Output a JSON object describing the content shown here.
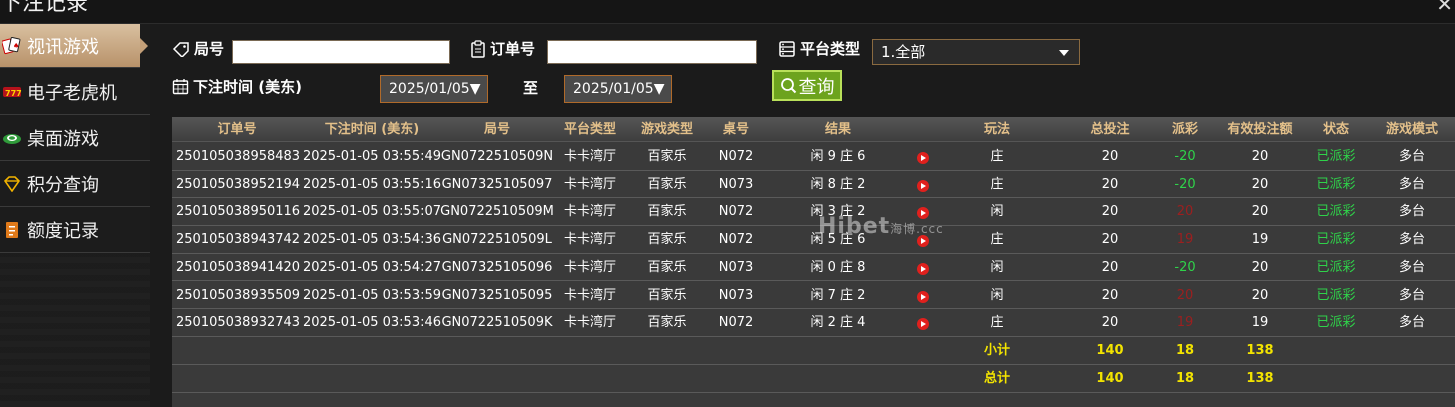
{
  "window": {
    "title": "下注记录",
    "close": "✕"
  },
  "sidebar": {
    "items": [
      {
        "label": "视讯游戏",
        "icon": "cards-icon",
        "active": true
      },
      {
        "label": "电子老虎机",
        "icon": "slot-icon",
        "active": false
      },
      {
        "label": "桌面游戏",
        "icon": "chip-icon",
        "active": false
      },
      {
        "label": "积分查询",
        "icon": "diamond-icon",
        "active": false
      },
      {
        "label": "额度记录",
        "icon": "document-icon",
        "active": false
      }
    ]
  },
  "filters": {
    "round_label": "局号",
    "round_value": "",
    "order_label": "订单号",
    "order_value": "",
    "platform_label": "平台类型",
    "platform_selected": "1.全部",
    "time_label": "下注时间 (美东)",
    "date_from": "2025/01/05▼",
    "to_label": "至",
    "date_to": "2025/01/05▼",
    "query_label": "查询"
  },
  "table": {
    "headers": [
      "订单号",
      "下注时间 (美东)",
      "局号",
      "平台类型",
      "游戏类型",
      "桌号",
      "结果",
      "玩法",
      "总投注",
      "派彩",
      "有效投注额",
      "状态",
      "游戏模式"
    ],
    "rows": [
      [
        "250105038958483",
        "2025-01-05 03:55:49",
        "GN0722510509N",
        "卡卡湾厅",
        "百家乐",
        "N072",
        "闲 9 庄 6",
        "庄",
        "20",
        "-20",
        "20",
        "已派彩",
        "多台"
      ],
      [
        "250105038952194",
        "2025-01-05 03:55:16",
        "GN07325105097",
        "卡卡湾厅",
        "百家乐",
        "N073",
        "闲 8 庄 2",
        "庄",
        "20",
        "-20",
        "20",
        "已派彩",
        "多台"
      ],
      [
        "250105038950116",
        "2025-01-05 03:55:07",
        "GN0722510509M",
        "卡卡湾厅",
        "百家乐",
        "N072",
        "闲 3 庄 2",
        "闲",
        "20",
        "20",
        "20",
        "已派彩",
        "多台"
      ],
      [
        "250105038943742",
        "2025-01-05 03:54:36",
        "GN0722510509L",
        "卡卡湾厅",
        "百家乐",
        "N072",
        "闲 5 庄 6",
        "庄",
        "20",
        "19",
        "19",
        "已派彩",
        "多台"
      ],
      [
        "250105038941420",
        "2025-01-05 03:54:27",
        "GN07325105096",
        "卡卡湾厅",
        "百家乐",
        "N073",
        "闲 0 庄 8",
        "闲",
        "20",
        "-20",
        "20",
        "已派彩",
        "多台"
      ],
      [
        "250105038935509",
        "2025-01-05 03:53:59",
        "GN07325105095",
        "卡卡湾厅",
        "百家乐",
        "N073",
        "闲 7 庄 2",
        "闲",
        "20",
        "20",
        "20",
        "已派彩",
        "多台"
      ],
      [
        "250105038932743",
        "2025-01-05 03:53:46",
        "GN0722510509K",
        "卡卡湾厅",
        "百家乐",
        "N072",
        "闲 2 庄 4",
        "庄",
        "20",
        "19",
        "19",
        "已派彩",
        "多台"
      ]
    ],
    "subtotal": {
      "label": "小计",
      "bet": "140",
      "payout": "18",
      "valid": "138"
    },
    "total": {
      "label": "总计",
      "bet": "140",
      "payout": "18",
      "valid": "138"
    }
  },
  "watermark": {
    "main": "Hibet",
    "suffix": "海博.ccc"
  },
  "colors": {
    "header_text": "#e3c08a",
    "positive": "#2fd24a",
    "negative": "#9c1f1f",
    "sum": "#f2e300",
    "accent": "#6da31e"
  }
}
